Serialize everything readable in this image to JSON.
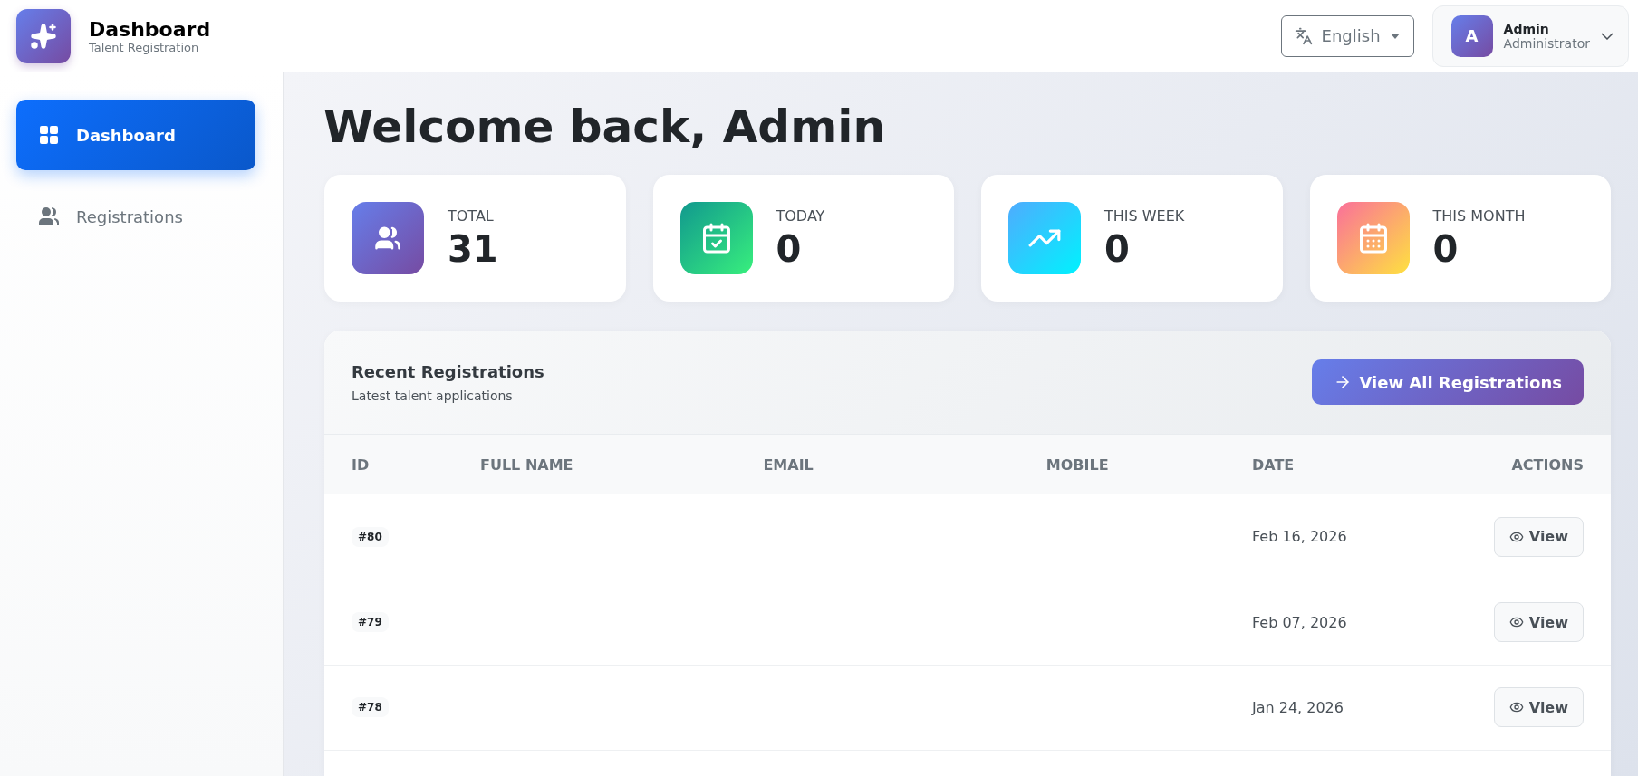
{
  "brand": {
    "title": "Dashboard",
    "subtitle": "Talent Registration"
  },
  "language": {
    "label": "English"
  },
  "user": {
    "initial": "A",
    "name": "Admin",
    "role": "Administrator"
  },
  "sidebar": {
    "items": [
      {
        "label": "Dashboard",
        "kind": "grid",
        "selected": true
      },
      {
        "label": "Registrations",
        "kind": "users",
        "selected": false
      }
    ]
  },
  "heading": "Welcome back, Admin",
  "stats": [
    {
      "label": "TOTAL",
      "value": "31",
      "kind": "users"
    },
    {
      "label": "TODAY",
      "value": "0",
      "kind": "today"
    },
    {
      "label": "THIS WEEK",
      "value": "0",
      "kind": "week"
    },
    {
      "label": "THIS MONTH",
      "value": "0",
      "kind": "month"
    }
  ],
  "recent": {
    "title": "Recent Registrations",
    "subtitle": "Latest talent applications",
    "button": "View All Registrations",
    "columns": [
      "ID",
      "FULL NAME",
      "EMAIL",
      "MOBILE",
      "DATE",
      "ACTIONS"
    ],
    "rows": [
      {
        "id": "#80",
        "date": "Feb 16, 2026",
        "action": "View"
      },
      {
        "id": "#79",
        "date": "Feb 07, 2026",
        "action": "View"
      },
      {
        "id": "#78",
        "date": "Jan 24, 2026",
        "action": "View"
      }
    ]
  }
}
